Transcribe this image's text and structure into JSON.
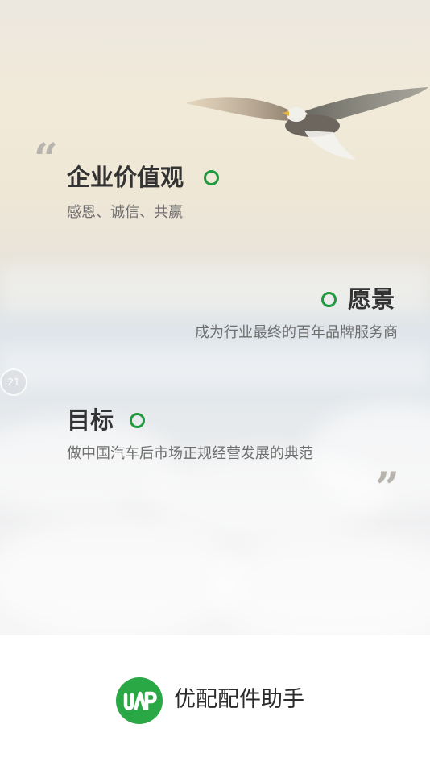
{
  "splash": {
    "countdown": "21",
    "sections": [
      {
        "title": "企业价值观",
        "description": "感恩、诚信、共赢"
      },
      {
        "title": "愿景",
        "description": "成为行业最终的百年品牌服务商"
      },
      {
        "title": "目标",
        "description": "做中国汽车后市场正规经营发展的典范"
      }
    ]
  },
  "footer": {
    "app_name": "优配配件助手"
  },
  "colors": {
    "accent": "#1f9a3e",
    "logo_green": "#2aa845"
  }
}
